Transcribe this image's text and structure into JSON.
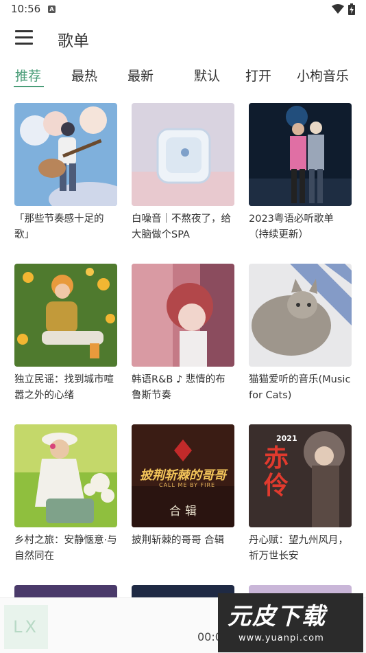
{
  "status_bar": {
    "time": "10:56",
    "notification_glyph": "A"
  },
  "app_bar": {
    "title": "歌单"
  },
  "tabs": [
    {
      "label": "推荐",
      "active": true
    },
    {
      "label": "最热"
    },
    {
      "label": "最新"
    },
    {
      "label": "默认"
    },
    {
      "label": "打开"
    },
    {
      "label": "小枸音乐"
    }
  ],
  "playlists": [
    {
      "title": "「那些节奏感十足的歌」"
    },
    {
      "title": "白噪音｜不熬夜了，给大脑做个SPA"
    },
    {
      "title": "2023粤语必听歌单（持续更新）"
    },
    {
      "title": "独立民谣：找到城市喧嚣之外的心绪"
    },
    {
      "title": "韩语R&B ♪ 悲情的布鲁斯节奏"
    },
    {
      "title": "猫猫爱听的音乐(Music for Cats)"
    },
    {
      "title": "乡村之旅：安静惬意·与自然同在"
    },
    {
      "title": "披荆斩棘的哥哥 合辑"
    },
    {
      "title": "丹心赋：望九州风月，祈万世长安"
    }
  ],
  "cover_text": {
    "brothers_title": "披荆斩棘的哥哥",
    "brothers_sub": "CALL ME BY FIRE",
    "brothers_album": "合辑",
    "red_title": "赤伶",
    "red_year": "2021"
  },
  "player": {
    "art_text": "LX",
    "time": "00:00"
  },
  "watermark": {
    "main": "元皮下载",
    "url": "www.yuanpi.com"
  },
  "colors": {
    "accent": "#4a9d78"
  }
}
